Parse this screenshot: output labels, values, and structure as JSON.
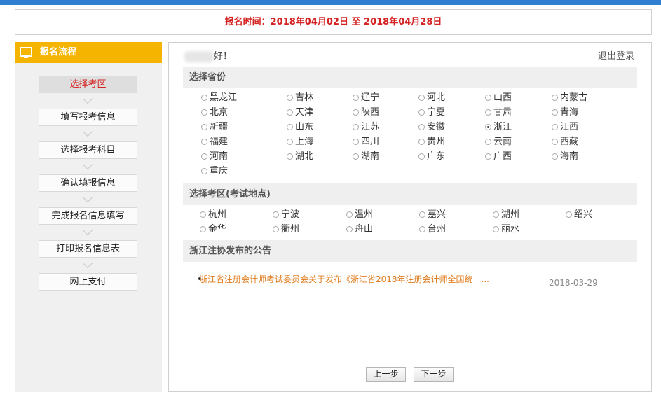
{
  "header": {
    "registration_time": "报名时间：2018年04月02日 至 2018年04月28日"
  },
  "sidebar": {
    "title": "报名流程",
    "steps": [
      "选择考区",
      "填写报考信息",
      "选择报考科目",
      "确认填报信息",
      "完成报名信息填写",
      "打印报名信息表",
      "网上支付"
    ],
    "active_step": 0
  },
  "main": {
    "greeting_suffix": "好！",
    "logout": "退出登录",
    "province_section": "选择省份",
    "provinces": [
      "黑龙江",
      "吉林",
      "辽宁",
      "河北",
      "山西",
      "内蒙古",
      "北京",
      "天津",
      "陕西",
      "宁夏",
      "甘肃",
      "青海",
      "新疆",
      "山东",
      "江苏",
      "安徽",
      "浙江",
      "江西",
      "福建",
      "上海",
      "四川",
      "贵州",
      "云南",
      "西藏",
      "河南",
      "湖北",
      "湖南",
      "广东",
      "广西",
      "海南",
      "重庆"
    ],
    "selected_province": "浙江",
    "area_section": "选择考区(考试地点)",
    "areas": [
      "杭州",
      "宁波",
      "温州",
      "嘉兴",
      "湖州",
      "绍兴",
      "金华",
      "衢州",
      "舟山",
      "台州",
      "丽水"
    ],
    "notice_section": "浙江注协发布的公告",
    "notices": [
      {
        "title": "浙江省注册会计师考试委员会关于发布《浙江省2018年注册会计师全国统一...",
        "date": "2018-03-29"
      }
    ],
    "prev_button": "上一步",
    "next_button": "下一步"
  },
  "colors": {
    "accent": "#f5b400",
    "alert": "#d42121",
    "notice": "#e07b1c",
    "topbar": "#2f7fd0"
  }
}
